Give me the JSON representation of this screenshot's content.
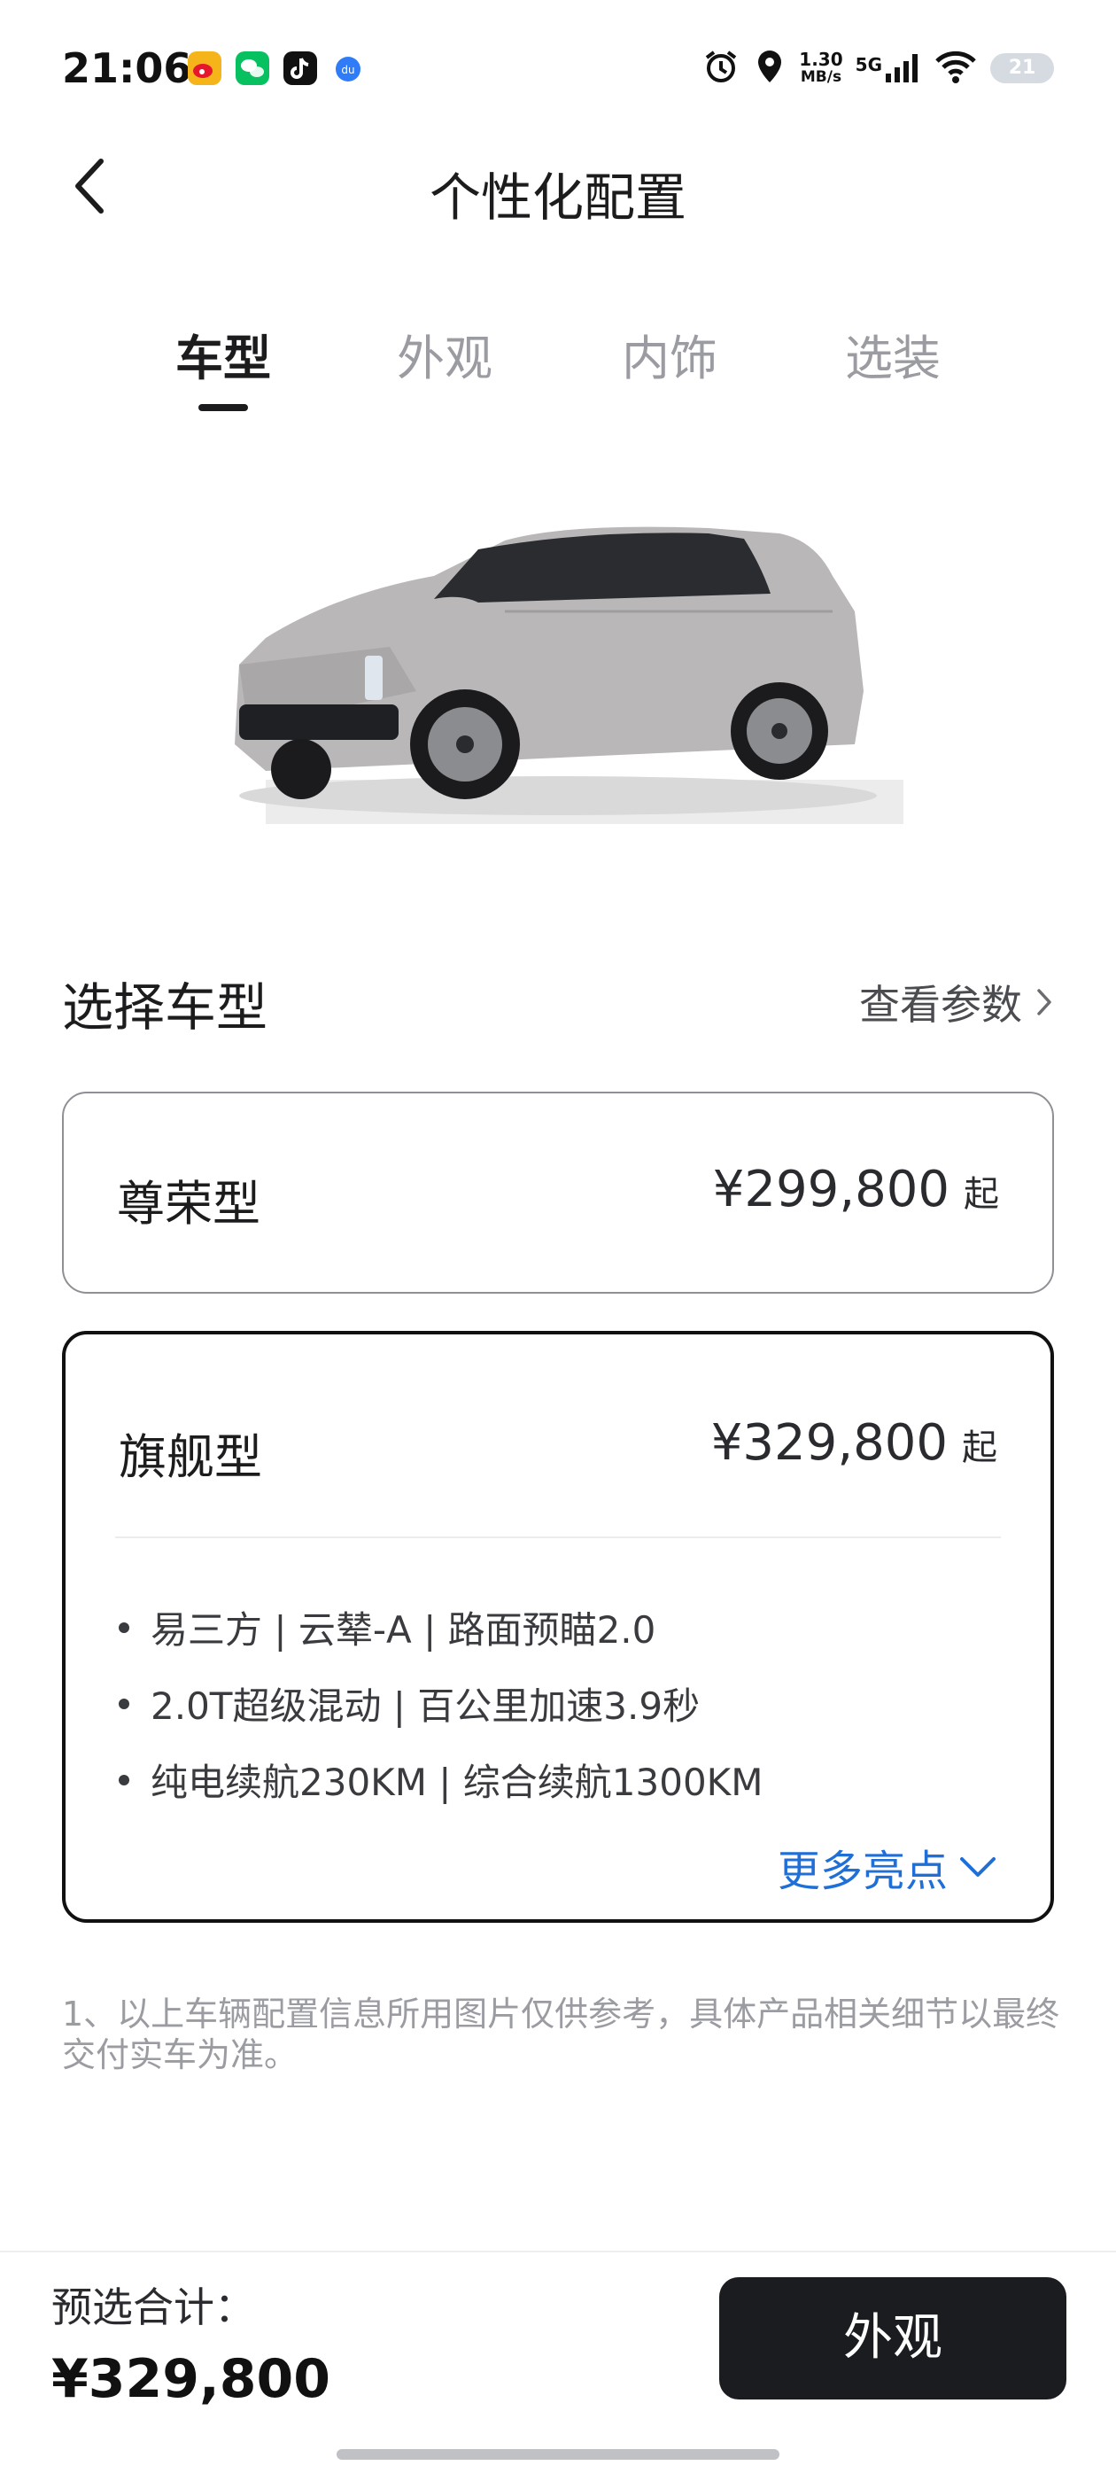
{
  "status_bar": {
    "time": "21:06",
    "net_speed_value": "1.30",
    "net_speed_unit": "MB/s",
    "network": "5G",
    "battery": "21",
    "apps": [
      "weibo-icon",
      "wechat-icon",
      "tiktok-icon",
      "du-icon"
    ]
  },
  "header": {
    "title": "个性化配置"
  },
  "tabs": [
    {
      "label": "车型",
      "active": true
    },
    {
      "label": "外观",
      "active": false
    },
    {
      "label": "内饰",
      "active": false
    },
    {
      "label": "选装",
      "active": false
    }
  ],
  "section": {
    "title": "选择车型",
    "params_link": "查看参数"
  },
  "trims": [
    {
      "name": "尊荣型",
      "price": "¥299,800",
      "suffix": "起",
      "selected": false
    },
    {
      "name": "旗舰型",
      "price": "¥329,800",
      "suffix": "起",
      "selected": true,
      "features": [
        "易三方 | 云辇-A | 路面预瞄2.0",
        "2.0T超级混动 | 百公里加速3.9秒",
        "纯电续航230KM | 综合续航1300KM"
      ],
      "more": "更多亮点"
    }
  ],
  "disclaimer": "1、以上车辆配置信息所用图片仅供参考，具体产品相关细节以最终交付实车为准。",
  "footer": {
    "total_label": "预选合计：",
    "total_value": "¥329,800",
    "next_button": "外观"
  },
  "colors": {
    "accent_link": "#1f6fd6",
    "primary_button": "#1b1c1f",
    "selected_border": "#111111"
  }
}
